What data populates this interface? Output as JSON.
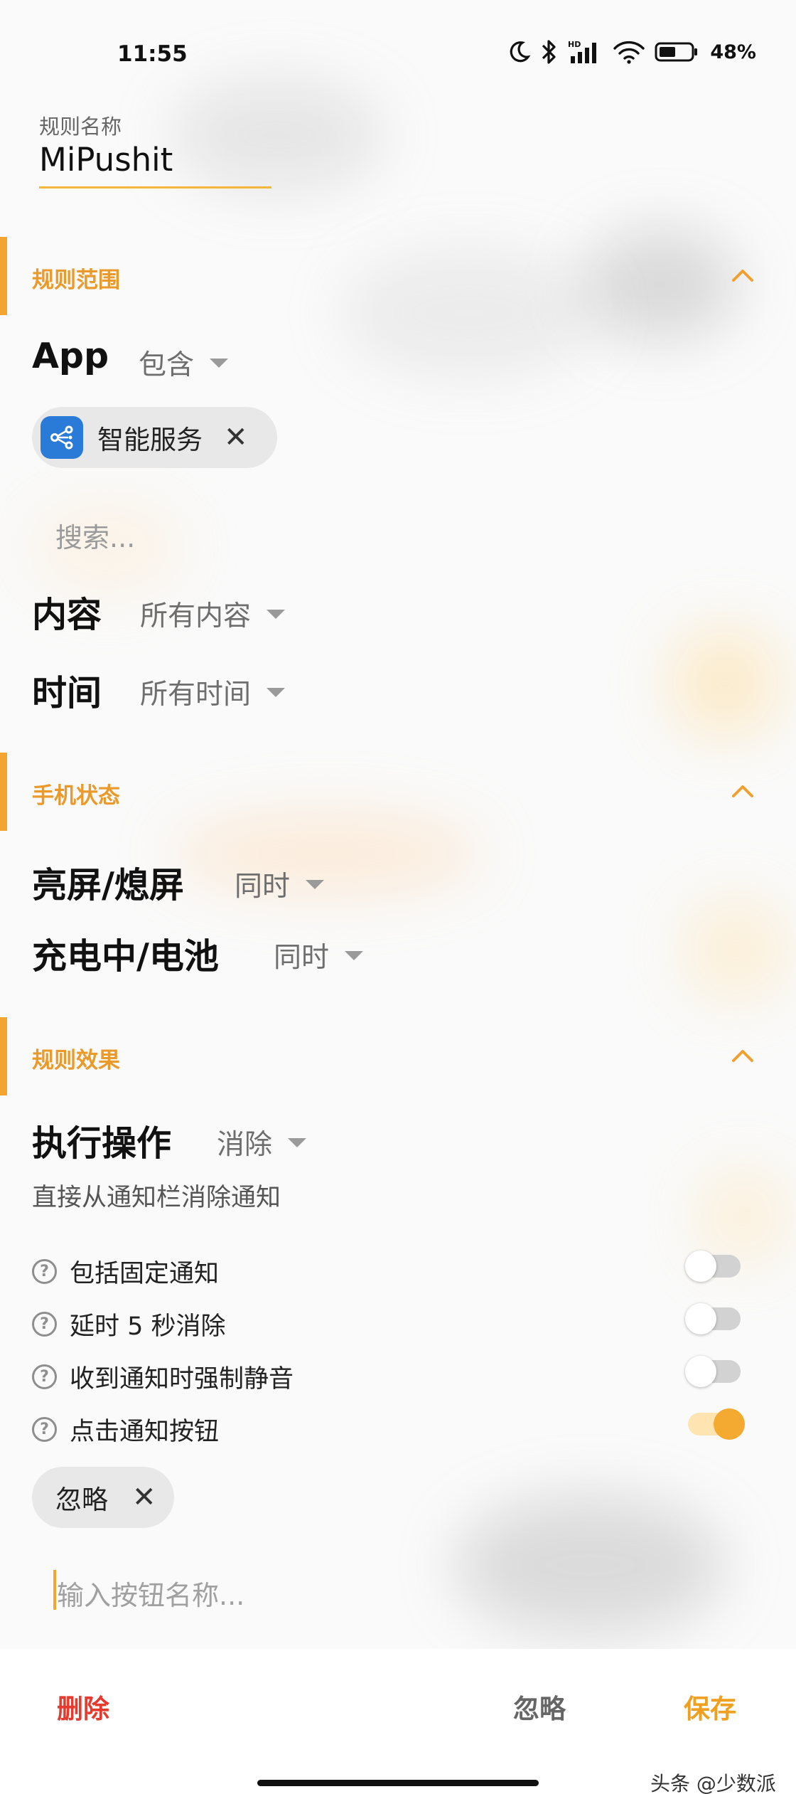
{
  "status_bar": {
    "time": "11:55",
    "battery": "48%",
    "icons": [
      "moon-icon",
      "bluetooth-icon",
      "hd-signal-icon",
      "wifi-icon",
      "battery-icon"
    ]
  },
  "rule_name": {
    "label": "规则名称",
    "value": "MiPushit"
  },
  "scope": {
    "title": "规则范围",
    "app_label": "App",
    "app_mode": "包含",
    "selected_app": "智能服务",
    "search_placeholder": "搜索...",
    "content_label": "内容",
    "content_value": "所有内容",
    "time_label": "时间",
    "time_value": "所有时间"
  },
  "phone_state": {
    "title": "手机状态",
    "screen_label": "亮屏/熄屏",
    "screen_value": "同时",
    "charging_label": "充电中/电池",
    "charging_value": "同时"
  },
  "effect": {
    "title": "规则效果",
    "action_label": "执行操作",
    "action_value": "消除",
    "description": "直接从通知栏消除通知",
    "options": [
      {
        "label": "包括固定通知",
        "on": false
      },
      {
        "label": "延时 5 秒消除",
        "on": false
      },
      {
        "label": "收到通知时强制静音",
        "on": false
      },
      {
        "label": "点击通知按钮",
        "on": true
      }
    ],
    "button_chip": "忽略",
    "button_input_placeholder": "输入按钮名称..."
  },
  "bottom": {
    "delete": "删除",
    "ignore": "忽略",
    "save": "保存"
  },
  "watermark": "头条 @少数派",
  "colors": {
    "accent": "#f4a530",
    "delete": "#e53b2f",
    "app_icon": "#2a7bd8"
  }
}
